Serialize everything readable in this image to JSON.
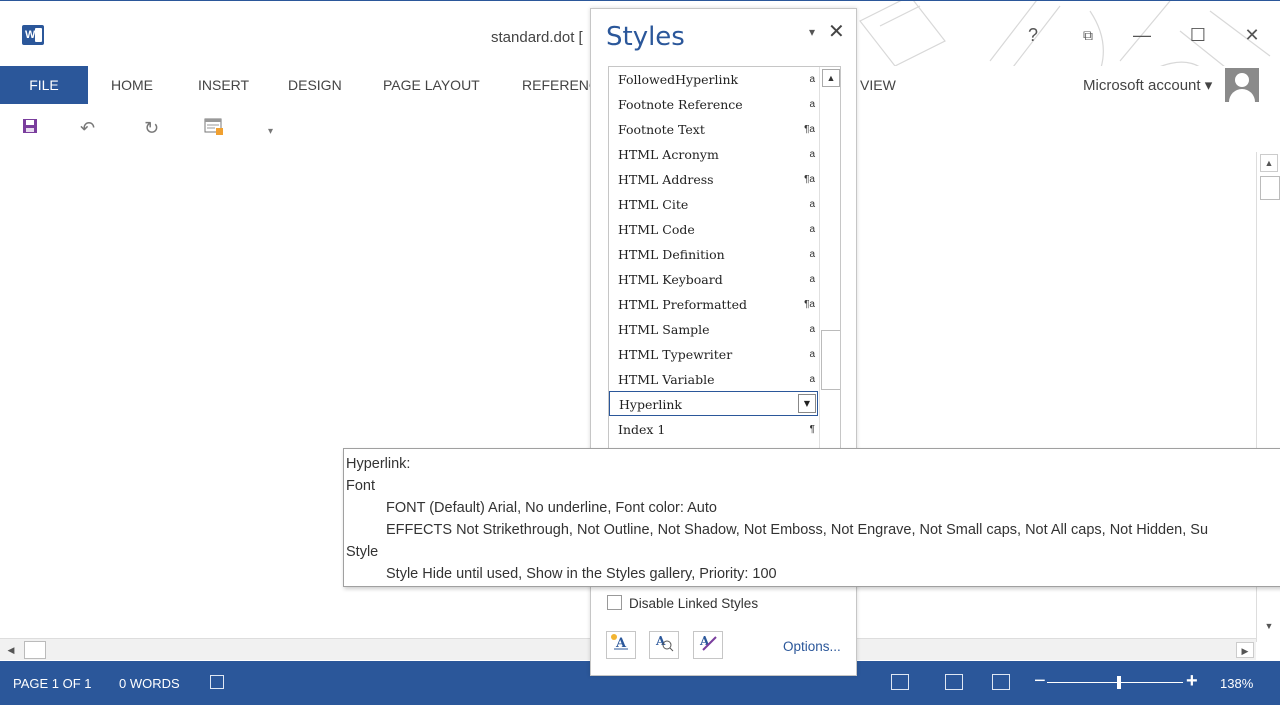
{
  "window": {
    "title": "standard.dot [",
    "help": "?",
    "restore": "⧉",
    "minimize": "—",
    "maximize": "☐",
    "close": "✕"
  },
  "ribbon": {
    "tabs": [
      "FILE",
      "HOME",
      "INSERT",
      "DESIGN",
      "PAGE LAYOUT",
      "REFERENC",
      "VIEW"
    ],
    "account": "Microsoft account ▾"
  },
  "qat": {
    "save": "💾",
    "undo": "↶",
    "redo": "↻",
    "custom": "▦",
    "more": "▾"
  },
  "styles_pane": {
    "title": "Styles",
    "menu": "▾",
    "close": "✕",
    "items": [
      {
        "name": "FollowedHyperlink",
        "mark": "a"
      },
      {
        "name": "Footnote Reference",
        "mark": "a"
      },
      {
        "name": "Footnote Text",
        "mark": "¶a"
      },
      {
        "name": "HTML Acronym",
        "mark": "a"
      },
      {
        "name": "HTML Address",
        "mark": "¶a"
      },
      {
        "name": "HTML Cite",
        "mark": "a"
      },
      {
        "name": "HTML Code",
        "mark": "a"
      },
      {
        "name": "HTML Definition",
        "mark": "a"
      },
      {
        "name": "HTML Keyboard",
        "mark": "a"
      },
      {
        "name": "HTML Preformatted",
        "mark": "¶a"
      },
      {
        "name": "HTML Sample",
        "mark": "a"
      },
      {
        "name": "HTML Typewriter",
        "mark": "a"
      },
      {
        "name": "HTML Variable",
        "mark": "a"
      },
      {
        "name": "Hyperlink",
        "mark": "▼"
      },
      {
        "name": "Index 1",
        "mark": "¶"
      }
    ],
    "disable_linked": "Disable Linked Styles",
    "options": "Options...",
    "btn_new": "A",
    "btn_inspect": "A",
    "btn_manage": "A"
  },
  "tooltip": {
    "line1": "Hyperlink:",
    "line2": "Font",
    "line3": "FONT  (Default) Arial, No underline, Font color: Auto",
    "line4": "EFFECTS  Not Strikethrough, Not Outline, Not Shadow, Not Emboss, Not Engrave, Not Small caps, Not All caps, Not Hidden, Su",
    "line5": "Style",
    "line6": "Style Hide until used, Show in the Styles gallery, Priority: 100"
  },
  "status": {
    "page": "PAGE 1 OF 1",
    "words": "0 WORDS",
    "zoom_minus": "−",
    "zoom_plus": "+",
    "zoom": "138%"
  },
  "colors": {
    "accent": "#2b579a"
  }
}
